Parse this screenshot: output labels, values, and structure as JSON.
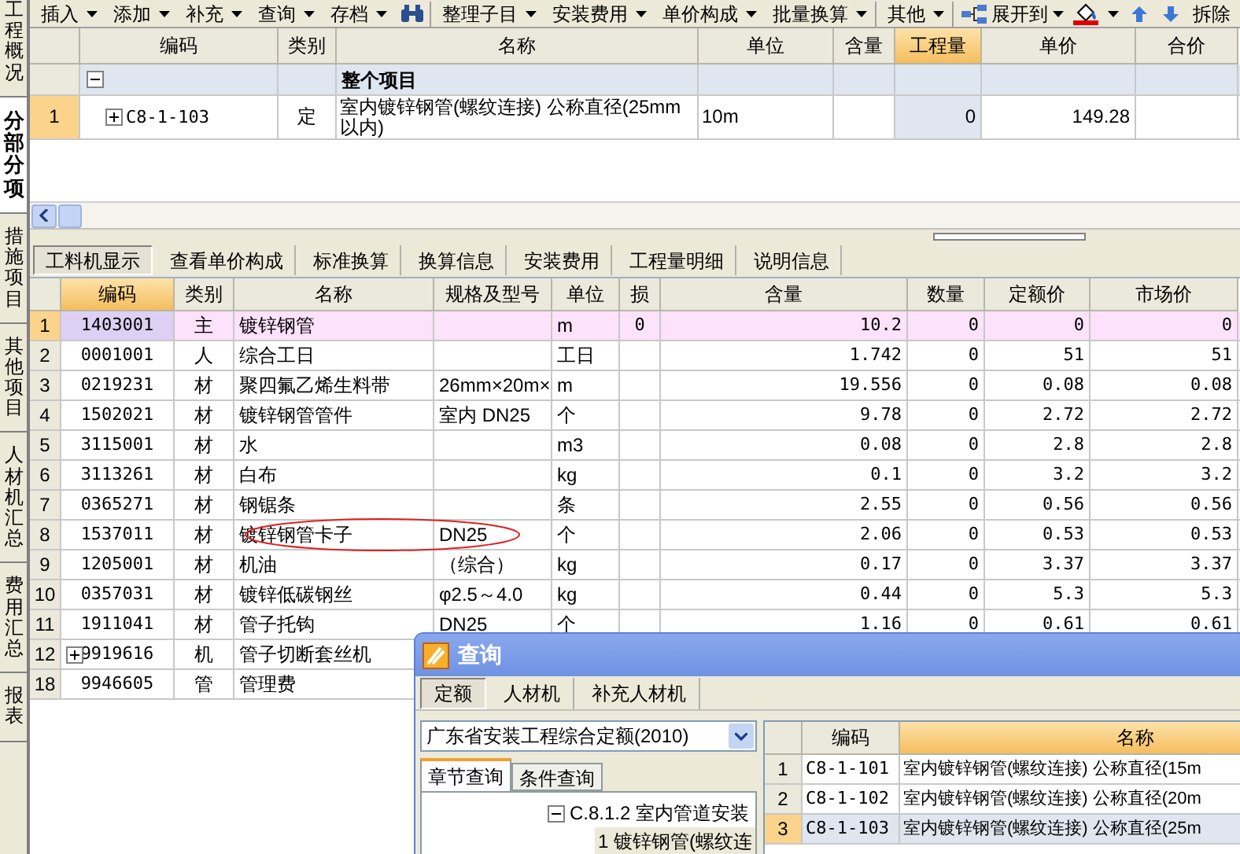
{
  "sidebar": {
    "tabs": [
      {
        "label": "工程概况",
        "selected": false
      },
      {
        "label": "分部分项",
        "selected": true
      },
      {
        "label": "措施项目",
        "selected": false
      },
      {
        "label": "其他项目",
        "selected": false
      },
      {
        "label": "人材机汇总",
        "selected": false
      },
      {
        "label": "费用汇总",
        "selected": false
      },
      {
        "label": "报表",
        "selected": false
      }
    ]
  },
  "toolbar": {
    "groups": [
      [
        {
          "kind": "menu",
          "label": "插入"
        },
        {
          "kind": "menu",
          "label": "添加"
        },
        {
          "kind": "menu",
          "label": "补充"
        },
        {
          "kind": "menu",
          "label": "查询"
        },
        {
          "kind": "menu",
          "label": "存档"
        },
        {
          "kind": "search"
        }
      ],
      [
        {
          "kind": "menu",
          "label": "整理子目"
        },
        {
          "kind": "menu",
          "label": "安装费用"
        },
        {
          "kind": "menu",
          "label": "单价构成"
        },
        {
          "kind": "menu",
          "label": "批量换算"
        }
      ],
      [
        {
          "kind": "menu",
          "label": "其他"
        }
      ],
      [
        {
          "kind": "expand",
          "label": "展开到"
        },
        {
          "kind": "fill"
        },
        {
          "kind": "move_up"
        },
        {
          "kind": "move_down"
        },
        {
          "kind": "button",
          "label": "拆除"
        }
      ]
    ]
  },
  "top_table": {
    "columns": [
      {
        "selected": false
      },
      {
        "label": "编码",
        "selected": false
      },
      {
        "label": "类别",
        "selected": false
      },
      {
        "label": "名称",
        "selected": false
      },
      {
        "label": "单位",
        "selected": false
      },
      {
        "label": "含量",
        "selected": false
      },
      {
        "label": "工程量",
        "selected": true
      },
      {
        "label": "单价",
        "selected": false
      },
      {
        "label": "合价",
        "selected": false
      }
    ],
    "rows": [
      {
        "kind": "group",
        "expanded": true,
        "name": "整个项目"
      },
      {
        "kind": "item",
        "expanded": false,
        "selected": true,
        "number": "1",
        "code": "C8-1-103",
        "category": "定",
        "name": "室内镀锌钢管(螺纹连接) 公称直径(25mm以内)",
        "unit": "10m",
        "quantity": "0",
        "unit_price": "149.28"
      }
    ]
  },
  "detail_tabs": [
    {
      "label": "工料机显示",
      "selected": true
    },
    {
      "label": "查看单价构成",
      "selected": false
    },
    {
      "label": "标准换算",
      "selected": false
    },
    {
      "label": "换算信息",
      "selected": false
    },
    {
      "label": "安装费用",
      "selected": false
    },
    {
      "label": "工程量明细",
      "selected": false
    },
    {
      "label": "说明信息",
      "selected": false
    }
  ],
  "detail_table": {
    "columns": [
      {
        "selected": false
      },
      {
        "label": "编码",
        "selected": true
      },
      {
        "label": "类别",
        "selected": false
      },
      {
        "label": "名称",
        "selected": false
      },
      {
        "label": "规格及型号",
        "selected": false
      },
      {
        "label": "单位",
        "selected": false
      },
      {
        "label": "损",
        "selected": false
      },
      {
        "label": "含量",
        "selected": false
      },
      {
        "label": "数量",
        "selected": false
      },
      {
        "label": "定额价",
        "selected": false
      },
      {
        "label": "市场价",
        "selected": false
      }
    ],
    "rows": [
      {
        "kind": "plain",
        "selected": true,
        "circled": false,
        "cells": [
          "1",
          "1403001",
          "主",
          "镀锌钢管",
          "",
          "m",
          "0",
          "10.2",
          "0",
          "0",
          "0"
        ]
      },
      {
        "kind": "plain",
        "selected": false,
        "circled": false,
        "cells": [
          "2",
          "0001001",
          "人",
          "综合工日",
          "",
          "工日",
          "",
          "1.742",
          "0",
          "51",
          "51"
        ]
      },
      {
        "kind": "plain",
        "selected": false,
        "circled": false,
        "cells": [
          "3",
          "0219231",
          "材",
          "聚四氟乙烯生料带",
          "26mm×20m×",
          "m",
          "",
          "19.556",
          "0",
          "0.08",
          "0.08"
        ]
      },
      {
        "kind": "plain",
        "selected": false,
        "circled": false,
        "cells": [
          "4",
          "1502021",
          "材",
          "镀锌钢管管件",
          "室内 DN25",
          "个",
          "",
          "9.78",
          "0",
          "2.72",
          "2.72"
        ]
      },
      {
        "kind": "plain",
        "selected": false,
        "circled": false,
        "cells": [
          "5",
          "3115001",
          "材",
          "水",
          "",
          "m3",
          "",
          "0.08",
          "0",
          "2.8",
          "2.8"
        ]
      },
      {
        "kind": "plain",
        "selected": false,
        "circled": false,
        "cells": [
          "6",
          "3113261",
          "材",
          "白布",
          "",
          "kg",
          "",
          "0.1",
          "0",
          "3.2",
          "3.2"
        ]
      },
      {
        "kind": "plain",
        "selected": false,
        "circled": false,
        "cells": [
          "7",
          "0365271",
          "材",
          "钢锯条",
          "",
          "条",
          "",
          "2.55",
          "0",
          "0.56",
          "0.56"
        ]
      },
      {
        "kind": "plain",
        "selected": false,
        "circled": true,
        "cells": [
          "8",
          "1537011",
          "材",
          "镀锌钢管卡子",
          "DN25",
          "个",
          "",
          "2.06",
          "0",
          "0.53",
          "0.53"
        ]
      },
      {
        "kind": "plain",
        "selected": false,
        "circled": false,
        "cells": [
          "9",
          "1205001",
          "材",
          "机油",
          "（综合）",
          "kg",
          "",
          "0.17",
          "0",
          "3.37",
          "3.37"
        ]
      },
      {
        "kind": "plain",
        "selected": false,
        "circled": false,
        "cells": [
          "10",
          "0357031",
          "材",
          "镀锌低碳钢丝",
          "φ2.5～4.0",
          "kg",
          "",
          "0.44",
          "0",
          "5.3",
          "5.3"
        ]
      },
      {
        "kind": "plain",
        "selected": false,
        "circled": false,
        "cells": [
          "11",
          "1911041",
          "材",
          "管子托钩",
          "DN25",
          "个",
          "",
          "1.16",
          "0",
          "0.61",
          "0.61"
        ]
      },
      {
        "kind": "group",
        "expanded": false,
        "selected": false,
        "circled": false,
        "cells": [
          "12",
          "9919616",
          "机",
          "管子切断套丝机"
        ]
      },
      {
        "kind": "plain",
        "selected": false,
        "circled": false,
        "cells": [
          "18",
          "9946605",
          "管",
          "管理费"
        ]
      }
    ]
  },
  "dialog": {
    "title": "查询",
    "tabs": [
      {
        "label": "定额",
        "selected": true
      },
      {
        "label": "人材机",
        "selected": false
      },
      {
        "label": "补充人材机",
        "selected": false
      }
    ],
    "library": "广东省安装工程综合定额(2010)",
    "search_tabs": [
      {
        "label": "章节查询",
        "selected": true
      },
      {
        "label": "条件查询",
        "selected": false
      }
    ],
    "tree": [
      {
        "label": "C.8.1.2 室内管道安装",
        "expanded": true,
        "selected": false,
        "children": [
          {
            "label": "1 镀锌钢管(螺纹连",
            "selected": true
          }
        ]
      }
    ],
    "results": {
      "columns": [
        {
          "selected": false
        },
        {
          "label": "编码",
          "selected": false
        },
        {
          "label": "名称",
          "selected": true
        }
      ],
      "rows": [
        {
          "number": "1",
          "code": "C8-1-101",
          "name": "室内镀锌钢管(螺纹连接) 公称直径(15m",
          "selected": false
        },
        {
          "number": "2",
          "code": "C8-1-102",
          "name": "室内镀锌钢管(螺纹连接) 公称直径(20m",
          "selected": false
        },
        {
          "number": "3",
          "code": "C8-1-103",
          "name": "室内镀锌钢管(螺纹连接) 公称直径(25m",
          "selected": true
        }
      ]
    }
  }
}
